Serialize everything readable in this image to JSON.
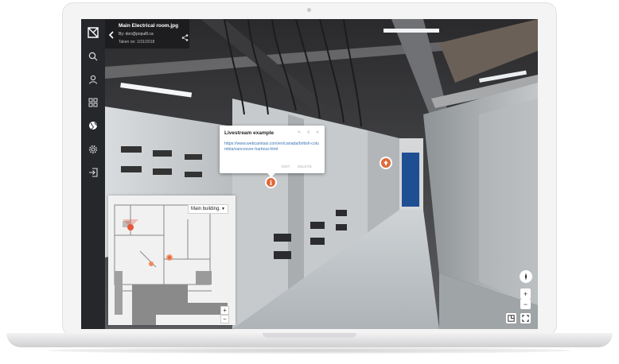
{
  "sidebar": {
    "items": [
      {
        "icon": "logo-icon"
      },
      {
        "icon": "search-icon"
      },
      {
        "icon": "user-icon"
      },
      {
        "icon": "grid-icon"
      },
      {
        "icon": "globe-icon"
      },
      {
        "icon": "gear-icon"
      },
      {
        "icon": "logout-icon"
      }
    ]
  },
  "header": {
    "title": "Main Electrical room.jpg",
    "by": "By: don@popul8.ca",
    "taken": "Taken on: 1/31/2018"
  },
  "popup": {
    "title": "Livestream example",
    "link": "https://www.webcamtaxi.com/en/canada/british-columbia/vancouver-harbour.html",
    "edit_label": "EDIT",
    "delete_label": "DELETE"
  },
  "minimap": {
    "building_select": "Main building.",
    "zoom_in": "+",
    "zoom_out": "−"
  },
  "viewer_controls": {
    "zoom_in": "+",
    "zoom_out": "−"
  },
  "colors": {
    "accent": "#e0683a",
    "sidebar_bg": "#26272b",
    "link": "#3b74b5"
  }
}
